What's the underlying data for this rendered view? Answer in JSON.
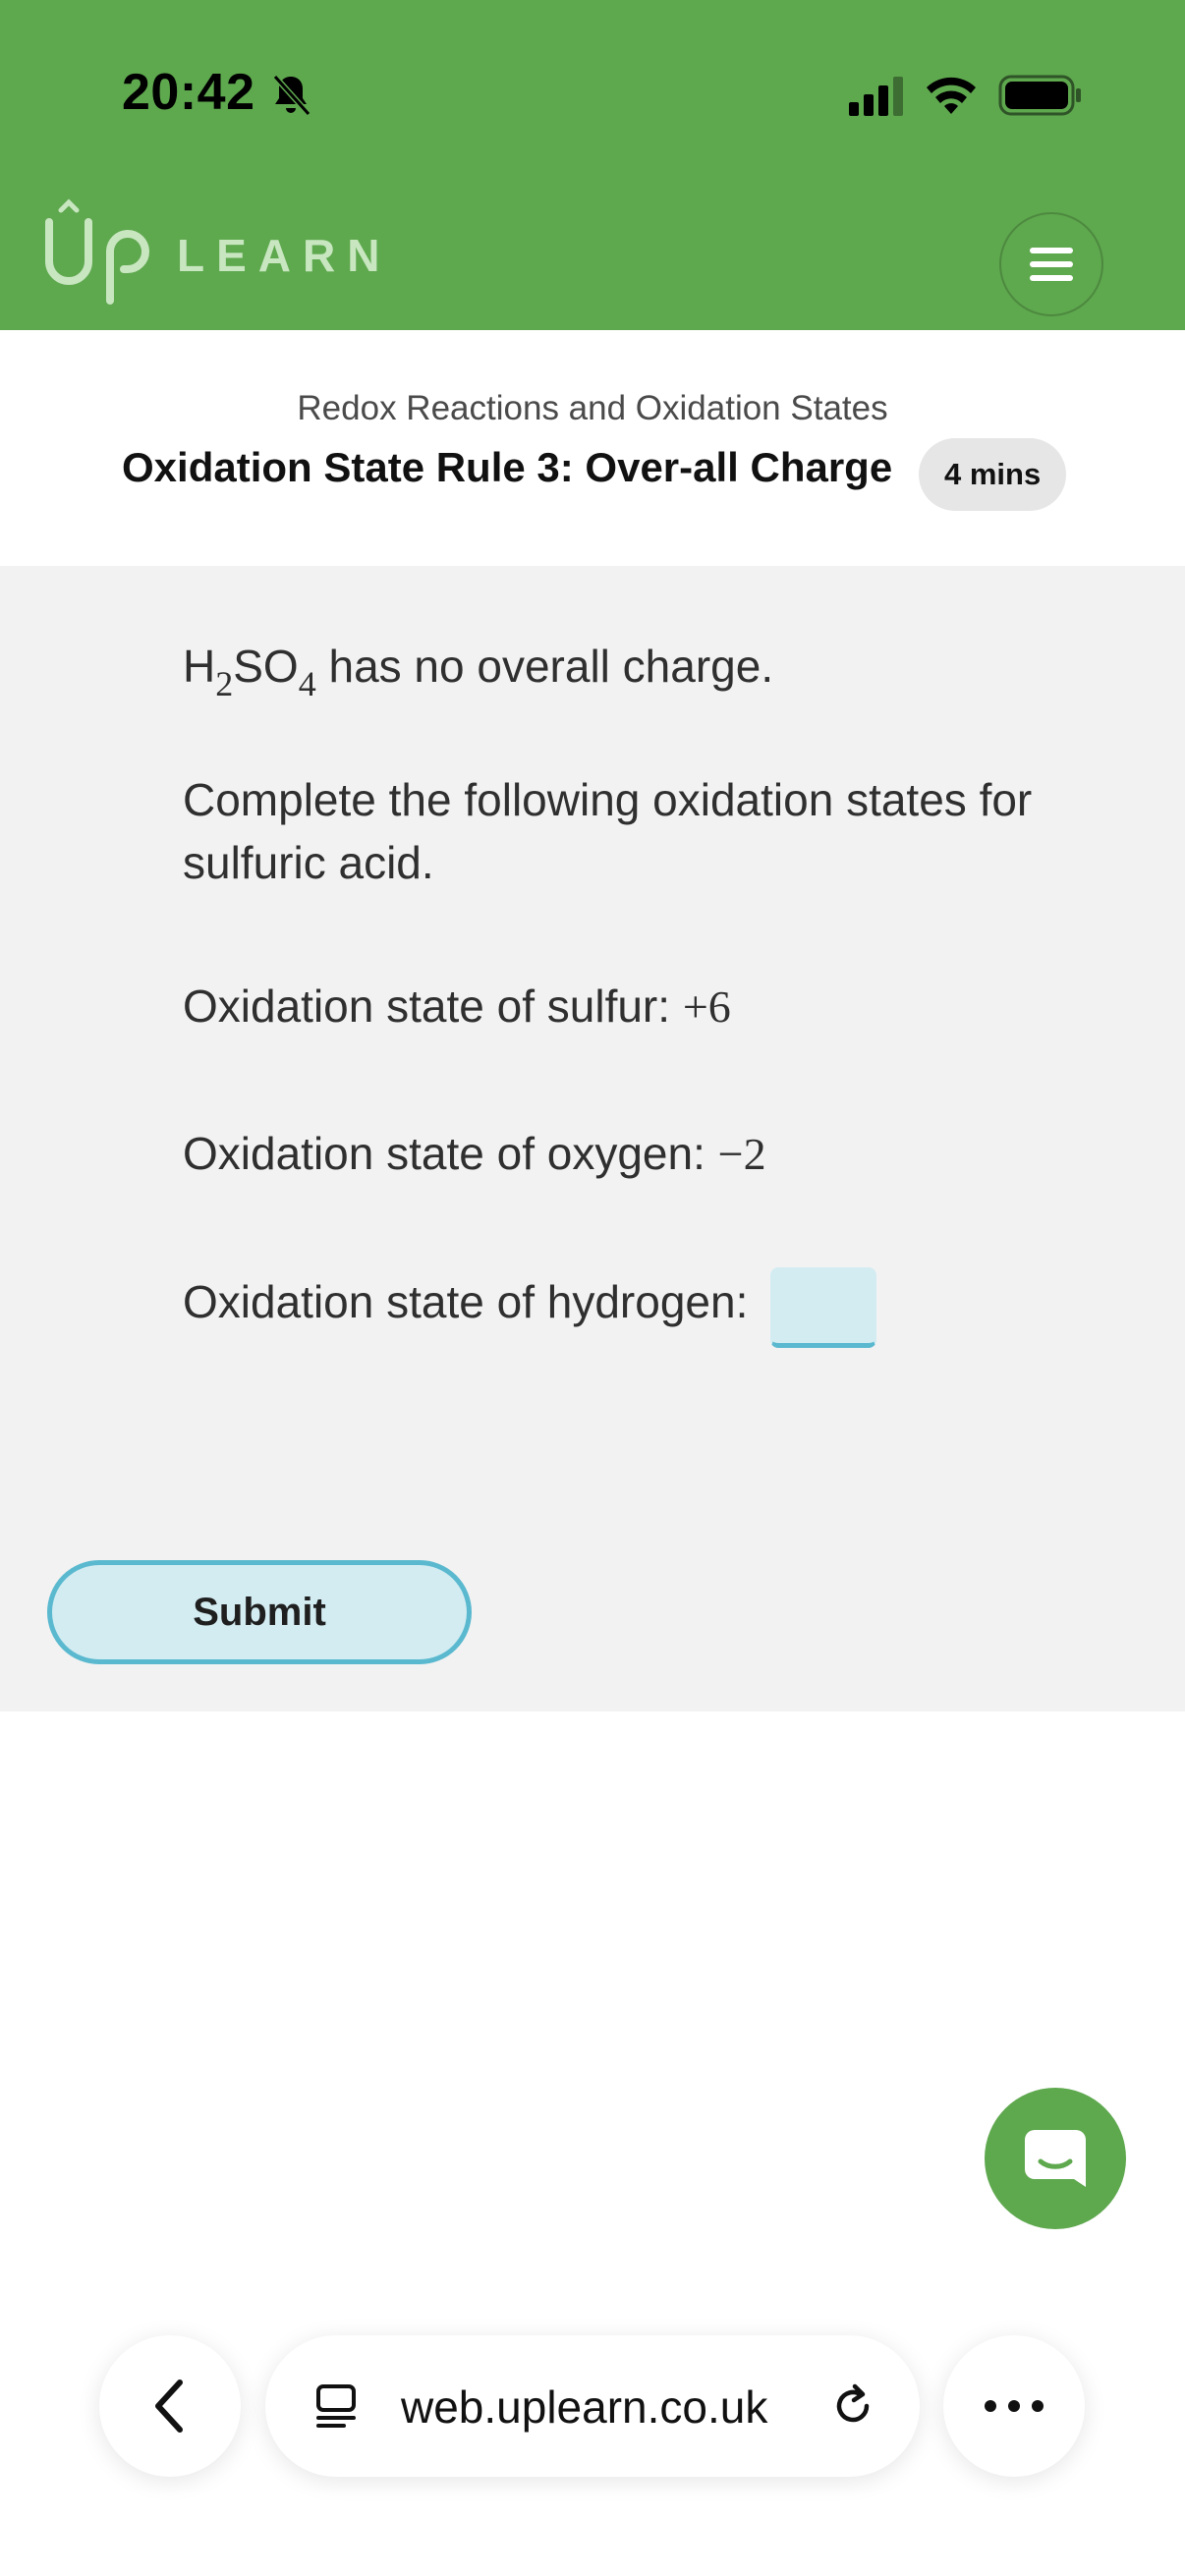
{
  "status_bar": {
    "time": "20:42",
    "icons": [
      "bell-slash-icon",
      "cellular-signal-icon",
      "wifi-icon",
      "battery-icon"
    ]
  },
  "header": {
    "brand_color": "#5ea84e",
    "logo_text": "UP LEARN",
    "menu_icon": "hamburger-menu-icon"
  },
  "lesson": {
    "breadcrumb": "Redox Reactions and Oxidation States",
    "title": "Oxidation State Rule 3: Over-all Charge",
    "duration": "4 mins"
  },
  "question": {
    "formula_h": "H",
    "formula_h_sub": "2",
    "formula_so": "SO",
    "formula_o_sub": "4",
    "formula_rest": " has no overall charge.",
    "instruction": "Complete the following oxidation states for sulfuric acid.",
    "sulfur_label": "Oxidation state of sulfur: ",
    "sulfur_value": "+6",
    "oxygen_label": "Oxidation state of oxygen: ",
    "oxygen_value": "−2",
    "hydrogen_label": "Oxidation state of hydrogen: ",
    "hydrogen_value": ""
  },
  "submit": {
    "label": "Submit",
    "accent": "#5ab9cf",
    "fill": "#d3ecf2"
  },
  "chat": {
    "icon": "chat-bubble-icon"
  },
  "browser": {
    "url": "web.uplearn.co.uk",
    "icons": [
      "back-chevron-icon",
      "tabs-icon",
      "reload-icon",
      "more-dots-icon"
    ]
  }
}
